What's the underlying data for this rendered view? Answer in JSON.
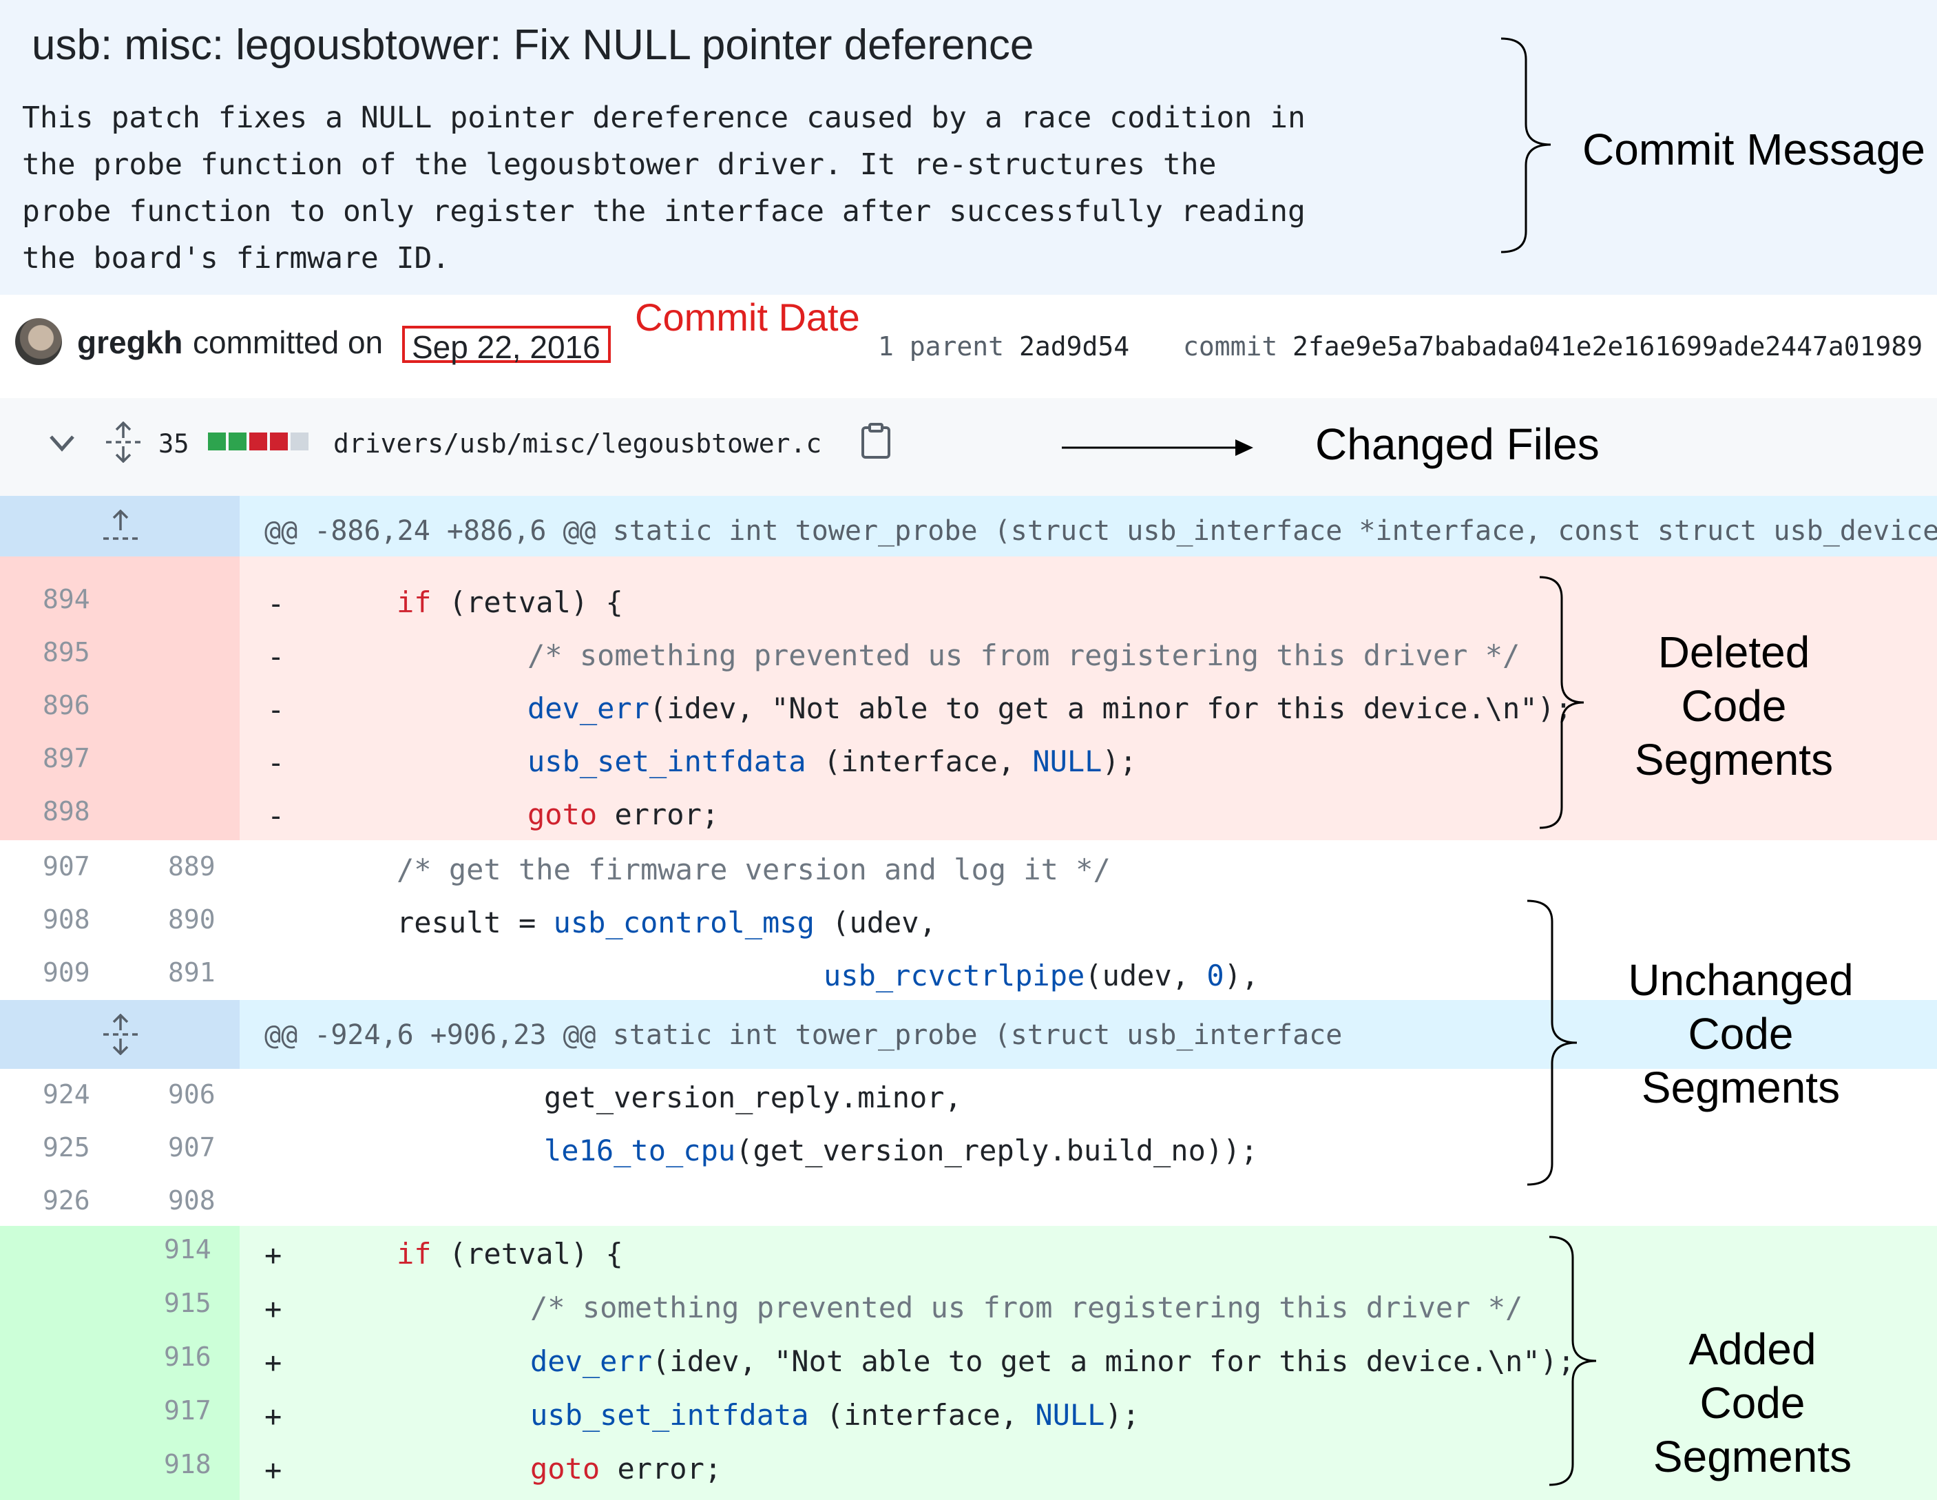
{
  "commit": {
    "title": "usb: misc: legousbtower: Fix NULL pointer deference",
    "message_lines": [
      "This patch fixes a NULL pointer dereference caused by a race codition in",
      "the probe function of the legousbtower driver. It re-structures the",
      "probe function to only register the interface after successfully reading",
      "the board's firmware ID."
    ],
    "author": "gregkh",
    "committed_text": "committed on",
    "date": "Sep 22, 2016",
    "parent_label": "1 parent",
    "parent_sha": "2ad9d54",
    "commit_label": "commit",
    "commit_sha": "2fae9e5a7babada041e2e161699ade2447a01989"
  },
  "file": {
    "changes_count": "35",
    "path": "drivers/usb/misc/legousbtower.c",
    "diffstat_colors": [
      "#2da44e",
      "#2da44e",
      "#cf222e",
      "#cf222e",
      "#d0d7de"
    ],
    "icons": [
      "chevron-down-icon",
      "unfold-icon",
      "copy-icon"
    ]
  },
  "diff": {
    "hunk1": "@@ -886,24 +886,6 @@ static int tower_probe (struct usb_interface *interface, const struct usb_device",
    "hunk2": "@@ -924,6 +906,23 @@ static int tower_probe (struct usb_interface",
    "deleted": [
      {
        "old": "894",
        "sign": "-",
        "parts": [
          [
            "",
            "if"
          ],
          [
            "p",
            " (retval) {"
          ]
        ]
      },
      {
        "old": "895",
        "sign": "-",
        "parts": [
          [
            "c",
            "/* something prevented us from registering this driver */"
          ]
        ]
      },
      {
        "old": "896",
        "sign": "-",
        "parts": [
          [
            "f",
            "dev_err"
          ],
          [
            "p",
            "(idev, \"Not able to get a minor for this device.\\n\");"
          ]
        ]
      },
      {
        "old": "897",
        "sign": "-",
        "parts": [
          [
            "f",
            "usb_set_intfdata"
          ],
          [
            "p",
            " (interface, "
          ],
          [
            "f",
            "NULL"
          ],
          [
            "p",
            ");"
          ]
        ]
      },
      {
        "old": "898",
        "sign": "-",
        "parts": [
          [
            "k",
            "goto"
          ],
          [
            "p",
            " error;"
          ]
        ]
      }
    ],
    "context1": [
      {
        "old": "907",
        "new": "889",
        "text": "/* get the firmware version and log it */"
      },
      {
        "old": "908",
        "new": "890",
        "text_a": "result = ",
        "fn": "usb_control_msg",
        "text_b": " (udev,"
      },
      {
        "old": "909",
        "new": "891",
        "fn": "usb_rcvctrlpipe",
        "text_b": "(udev, ",
        "num": "0",
        "text_c": "),"
      }
    ],
    "context2": [
      {
        "old": "924",
        "new": "906",
        "text": "get_version_reply.minor,"
      },
      {
        "old": "925",
        "new": "907",
        "fn": "le16_to_cpu",
        "text_b": "(get_version_reply.build_no));"
      },
      {
        "old": "926",
        "new": "908",
        "text": ""
      }
    ],
    "added": [
      {
        "new": "914",
        "sign": "+"
      },
      {
        "new": "915",
        "sign": "+"
      },
      {
        "new": "916",
        "sign": "+"
      },
      {
        "new": "917",
        "sign": "+"
      },
      {
        "new": "918",
        "sign": "+"
      }
    ],
    "code": {
      "if": "if",
      "retval": " (retval) {",
      "comment": "/* something prevented us from registering this driver */",
      "dev_err": "dev_err",
      "dev_err_args": "(idev, \"Not able to get a minor for this device.\\n\");",
      "usb_set_intfdata": "usb_set_intfdata",
      "interface_args": " (interface, ",
      "null": "NULL",
      "close": ");",
      "goto": "goto",
      "error": " error;"
    }
  },
  "annotations": {
    "commit_message": "Commit Message",
    "commit_date": "Commit Date",
    "changed_files": "Changed Files",
    "deleted": [
      "Deleted",
      "Code",
      "Segments"
    ],
    "unchanged": [
      "Unchanged",
      "Code",
      "Segments"
    ],
    "added": [
      "Added",
      "Code",
      "Segments"
    ]
  }
}
